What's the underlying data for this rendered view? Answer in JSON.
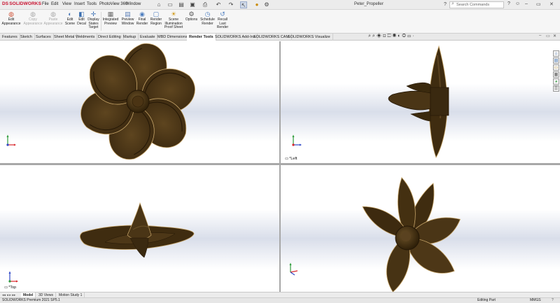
{
  "app": {
    "logo": "SOLIDWORKS",
    "document_title": "Peter_Propeller",
    "search_placeholder": "Search Commands",
    "menus": [
      "File",
      "Edit",
      "View",
      "Insert",
      "Tools",
      "PhotoView 360",
      "Window"
    ]
  },
  "quick_access": [
    {
      "name": "home-icon",
      "glyph": "⌂"
    },
    {
      "name": "new-document-icon",
      "glyph": "▭"
    },
    {
      "name": "open-icon",
      "glyph": "▤"
    },
    {
      "name": "save-icon",
      "glyph": "▣"
    },
    {
      "name": "print-icon",
      "glyph": "⎙"
    },
    {
      "name": "undo-icon",
      "glyph": "↶"
    },
    {
      "name": "redo-icon",
      "glyph": "↷"
    },
    {
      "name": "select-icon",
      "glyph": "↖"
    },
    {
      "name": "traffic-light-icon",
      "glyph": "●"
    },
    {
      "name": "options-gear-icon",
      "glyph": "⚙"
    }
  ],
  "ribbon": {
    "buttons": [
      {
        "id": "edit-appearance",
        "lines": [
          "Edit",
          "Appearance"
        ],
        "enabled": true,
        "glyph": "◍"
      },
      {
        "id": "copy-appearance",
        "lines": [
          "Copy",
          "Appearance"
        ],
        "enabled": false,
        "glyph": "◍"
      },
      {
        "id": "paste-appearance",
        "lines": [
          "Paste",
          "Appearance"
        ],
        "enabled": false,
        "glyph": "◍"
      },
      {
        "id": "edit-scene",
        "lines": [
          "Edit",
          "Scene"
        ],
        "enabled": true,
        "glyph": "◐"
      },
      {
        "id": "edit-decal",
        "lines": [
          "Edit",
          "Decal"
        ],
        "enabled": true,
        "glyph": "◧"
      },
      {
        "id": "display-states-target",
        "lines": [
          "Display",
          "States",
          "Target"
        ],
        "enabled": true,
        "glyph": "✛"
      },
      {
        "id": "integrated-preview",
        "lines": [
          "Integrated",
          "Preview"
        ],
        "enabled": true,
        "glyph": "▦"
      },
      {
        "id": "preview-window",
        "lines": [
          "Preview",
          "Window"
        ],
        "enabled": true,
        "glyph": "▤"
      },
      {
        "id": "final-render",
        "lines": [
          "Final",
          "Render"
        ],
        "enabled": true,
        "glyph": "◉"
      },
      {
        "id": "render-region",
        "lines": [
          "Render",
          "Region"
        ],
        "enabled": true,
        "glyph": "▢"
      },
      {
        "id": "scene-illumination-proof-sheet",
        "lines": [
          "Scene",
          "Illumination",
          "Proof Sheet"
        ],
        "enabled": true,
        "glyph": "☀"
      },
      {
        "id": "options",
        "lines": [
          "Options"
        ],
        "enabled": true,
        "glyph": "⚙"
      },
      {
        "id": "schedule-render",
        "lines": [
          "Schedule",
          "Render"
        ],
        "enabled": true,
        "glyph": "◷"
      },
      {
        "id": "recall-last-render",
        "lines": [
          "Recall",
          "Last",
          "Render"
        ],
        "enabled": true,
        "glyph": "↺"
      }
    ]
  },
  "command_tabs": [
    "Features",
    "Sketch",
    "Surfaces",
    "Sheet Metal",
    "Weldments",
    "Direct Editing",
    "Markup",
    "Evaluate",
    "MBD Dimensions",
    "Render Tools",
    "SOLIDWORKS Add-Ins",
    "SOLIDWORKS CAM",
    "SOLIDWORKS Visualize"
  ],
  "active_command_tab": "Render Tools",
  "viewports": {
    "top_left": {
      "label": ""
    },
    "top_right": {
      "label": "*Left"
    },
    "bottom_left": {
      "label": "*Top"
    },
    "bottom_right": {
      "label": ""
    }
  },
  "model_color": "#4a3516",
  "task_pane_icons": [
    "resources-icon",
    "design-library-icon",
    "file-explorer-icon",
    "view-palette-icon",
    "appearances-icon",
    "custom-properties-icon"
  ],
  "bottom_tabs": [
    "Model",
    "3D Views",
    "Motion Study 1"
  ],
  "active_bottom_tab": "Model",
  "status": {
    "product": "SOLIDWORKS Premium 2021 SP5.1",
    "mode": "Editing Part",
    "units": "MMGS"
  }
}
